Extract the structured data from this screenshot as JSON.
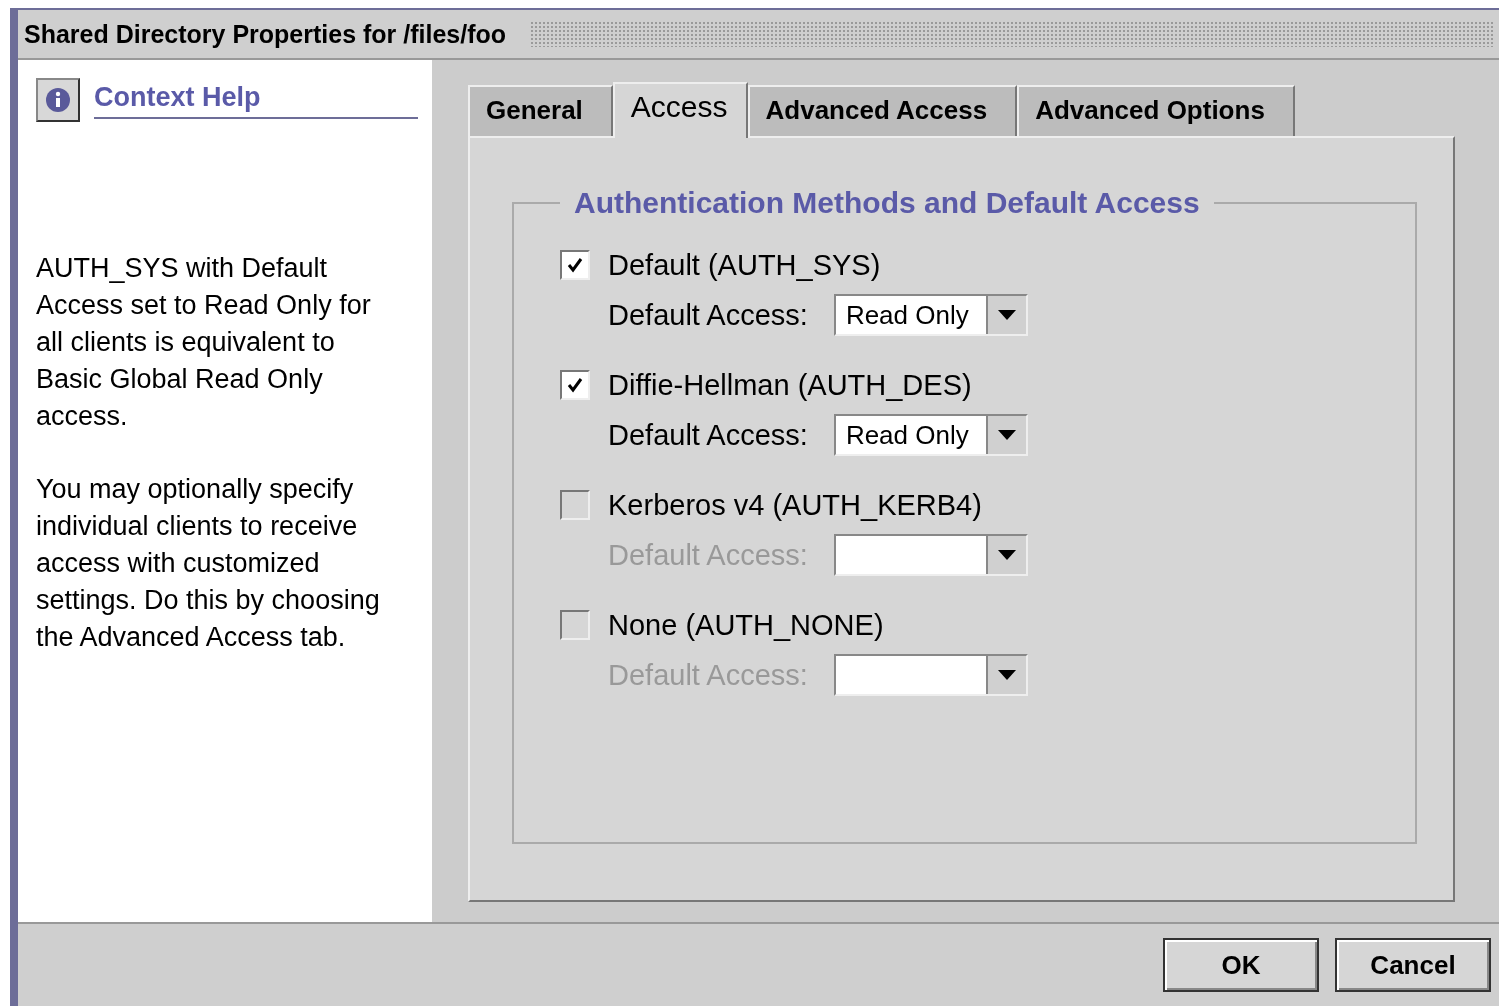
{
  "window": {
    "title": "Shared Directory Properties for /files/foo"
  },
  "help": {
    "title": "Context Help",
    "paragraphs": [
      "AUTH_SYS with Default Access set to Read Only for all clients is equivalent to Basic Global Read Only access.",
      "You may optionally specify individual clients to receive access with customized settings.  Do this by choosing the  Advanced Access tab."
    ]
  },
  "tabs": [
    {
      "label": "General",
      "selected": false
    },
    {
      "label": "Access",
      "selected": true
    },
    {
      "label": "Advanced Access",
      "selected": false
    },
    {
      "label": "Advanced Options",
      "selected": false
    }
  ],
  "group": {
    "title": "Authentication Methods and Default Access",
    "methods": [
      {
        "label": "Default (AUTH_SYS)",
        "checked": true,
        "access_label": "Default Access:",
        "access_value": "Read Only",
        "disabled": false
      },
      {
        "label": "Diffie-Hellman (AUTH_DES)",
        "checked": true,
        "access_label": "Default Access:",
        "access_value": "Read Only",
        "disabled": false
      },
      {
        "label": "Kerberos v4 (AUTH_KERB4)",
        "checked": false,
        "access_label": "Default Access:",
        "disabled": true
      },
      {
        "label": "None (AUTH_NONE)",
        "checked": false,
        "access_label": "Default Access:",
        "disabled": true
      }
    ]
  },
  "buttons": [
    "OK",
    "Cancel"
  ]
}
